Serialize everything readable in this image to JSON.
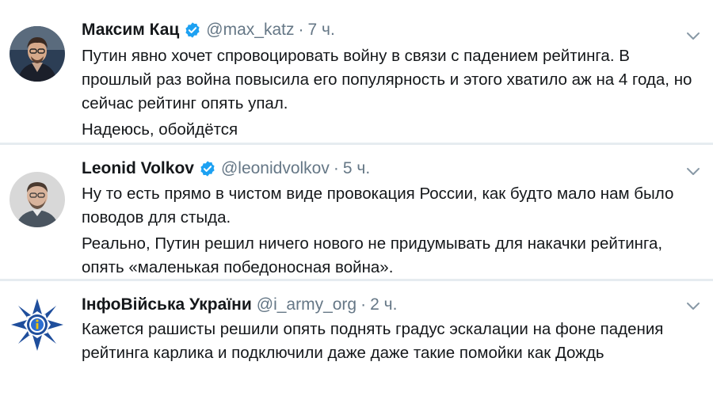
{
  "tweets": [
    {
      "name": "Максим Кац",
      "handle": "@max_katz",
      "separator": "·",
      "time": "7 ч.",
      "verified": true,
      "paragraphs": [
        "Путин явно хочет спровоцировать войну в связи с падением рейтинга. В прошлый раз война повысила его популярность и этого хватило аж на 4 года, но сейчас рейтинг опять упал.",
        "Надеюсь, обойдётся"
      ]
    },
    {
      "name": "Leonid Volkov",
      "handle": "@leonidvolkov",
      "separator": "·",
      "time": "5 ч.",
      "verified": true,
      "paragraphs": [
        "Ну то есть прямо в чистом виде провокация России, как будто мало нам было поводов для стыда.",
        "Реально, Путин решил ничего нового не придумывать для накачки рейтинга, опять «маленькая победоносная война»."
      ]
    },
    {
      "name": "ІнфоВійська України",
      "handle": "@i_army_org",
      "separator": "·",
      "time": "2 ч.",
      "verified": false,
      "paragraphs": [
        "Кажется рашисты решили опять поднять градус эскалации на фоне падения рейтинга карлика и подключили даже даже такие помойки как Дождь"
      ]
    }
  ],
  "colors": {
    "verified_blue": "#1da1f2",
    "secondary_text": "#657786",
    "divider": "#e6ecf0"
  },
  "icons": {
    "verified": "verified-badge-icon",
    "menu": "chevron-down-icon"
  }
}
